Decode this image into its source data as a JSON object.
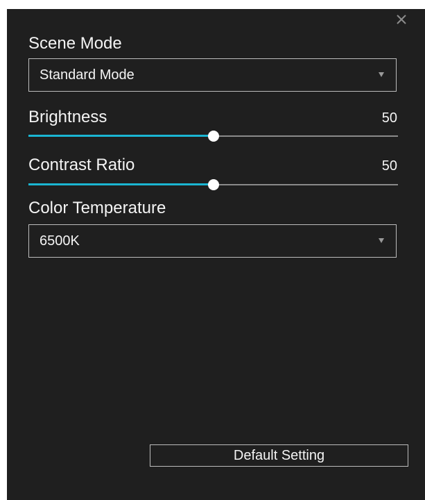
{
  "panel": {
    "close_icon": "close-icon"
  },
  "scene_mode": {
    "label": "Scene Mode",
    "selected": "Standard Mode",
    "arrow_icon": "chevron-down-icon"
  },
  "brightness": {
    "label": "Brightness",
    "value": "50",
    "level_percent": 50
  },
  "contrast": {
    "label": "Contrast Ratio",
    "value": "50",
    "level_percent": 50
  },
  "color_temperature": {
    "label": "Color Temperature",
    "selected": "6500K",
    "arrow_icon": "chevron-down-icon"
  },
  "footer": {
    "default_label": "Default Setting"
  },
  "colors": {
    "panel_bg": "#1f1f1f",
    "accent": "#1ab5d2",
    "track": "#8a8a8a",
    "border": "#bdbdbd"
  }
}
